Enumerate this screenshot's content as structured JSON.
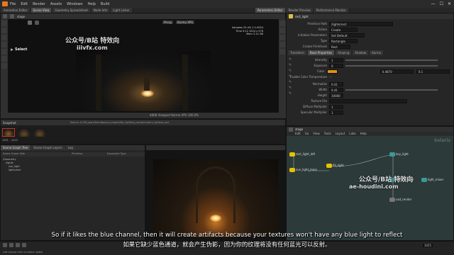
{
  "menu": {
    "items": [
      "File",
      "Edit",
      "Render",
      "Assets",
      "Windows",
      "Help",
      "Build"
    ],
    "window_controls": [
      "—",
      "☐",
      "✕"
    ]
  },
  "tabs": {
    "top": [
      "Animation Editor",
      "Scene View",
      "Geometry Spreadsheet",
      "Node Info",
      "Light Linker"
    ],
    "right": [
      "Parameters Editor",
      "Render Preview",
      "Performance Monitor"
    ]
  },
  "viewport": {
    "path_label": "stage",
    "mode_label": "Select",
    "persp_label": "Persp",
    "cam_label": "Karma XPU",
    "stats_lines": [
      "Samples 25.4%  1:1.0054",
      "Time 0:12  1024 x 576",
      "Mem 3.12 GB"
    ],
    "bottom_status": "4808 Viewport    Karma XPU  100.0%"
  },
  "timeline": {
    "left_label": "Snapshot",
    "path": "Source: S:/3D_work/Sandbox/ue_project/ttp_lighting_comp/renders_lighting.usd",
    "frame_start": "1001",
    "frame_end": "1025"
  },
  "scene_graph": {
    "tabs": [
      "Scene Graph Tree",
      "Scene Graph Layers",
      "Log"
    ],
    "header": [
      "Scene Graph Path",
      "Primitive",
      "Expanded Type"
    ],
    "rows": [
      "/Geometry",
      "/lights",
      "sun_light",
      "lights/rect"
    ]
  },
  "params": {
    "node_name": "rect_light",
    "top_rows": [
      {
        "label": "Primitive Path",
        "value": "/lights/rect"
      },
      {
        "label": "Action",
        "value": "Create"
      },
      {
        "label": "Initialize Parameters",
        "value": "Set Default"
      },
      {
        "label": "Type",
        "value": "Rectangle"
      },
      {
        "label": "Create Primitives",
        "value": "Rect"
      }
    ],
    "sub_tabs": [
      "Transform",
      "Base Properties",
      "Shaping",
      "Shadow",
      "Karma"
    ],
    "rows": [
      {
        "label": "Intensity",
        "value": "1"
      },
      {
        "label": "Exposure",
        "value": "0"
      },
      {
        "label": "Color",
        "value": "",
        "extra1": "0.4870",
        "extra2": "0.1"
      },
      {
        "label": "Enable Color Temperature",
        "value": "—"
      },
      {
        "label": "Normalize",
        "value": "0.41"
      },
      {
        "label": "Width",
        "value": "0.41"
      },
      {
        "label": "Height",
        "value": "10000"
      },
      {
        "label": "Texture File",
        "value": ""
      },
      {
        "label": "Diffuse Multiplier",
        "value": "1"
      },
      {
        "label": "Specular Multiplier",
        "value": "1"
      }
    ]
  },
  "network": {
    "path": "stage",
    "menu": [
      "Edit",
      "Go",
      "View",
      "Tools",
      "Layout",
      "Labs",
      "Help"
    ],
    "watermark_label": "Solaris",
    "nodes": [
      {
        "name": "rect_light_left"
      },
      {
        "name": "sun_light_main"
      },
      {
        "name": "fill_light"
      },
      {
        "name": "key_light"
      },
      {
        "name": "karmarender"
      },
      {
        "name": "light_mixer"
      },
      {
        "name": "usd_render"
      }
    ]
  },
  "watermarks": {
    "top_cn": "公众号/B站 特效向",
    "top_url": "iiivfx.com",
    "mid_cn": "公众号/B站 特效向",
    "mid_url": "ae-houdini.com"
  },
  "subtitles": {
    "english": "So if it likes the blue channel, then it will create artifacts because your textures won't have any blue light to reflect",
    "chinese": "如果它缺少蓝色通道，就会产生伪影，因为你的纹理将没有任何蓝光可以反射。"
  },
  "status_bar": {
    "left": "Left mouse click to select nodes",
    "frame_label": "1025"
  },
  "colors": {
    "accent": "#e8781e",
    "node_yellow": "#e6c200",
    "color_swatch": "#e0901a"
  }
}
